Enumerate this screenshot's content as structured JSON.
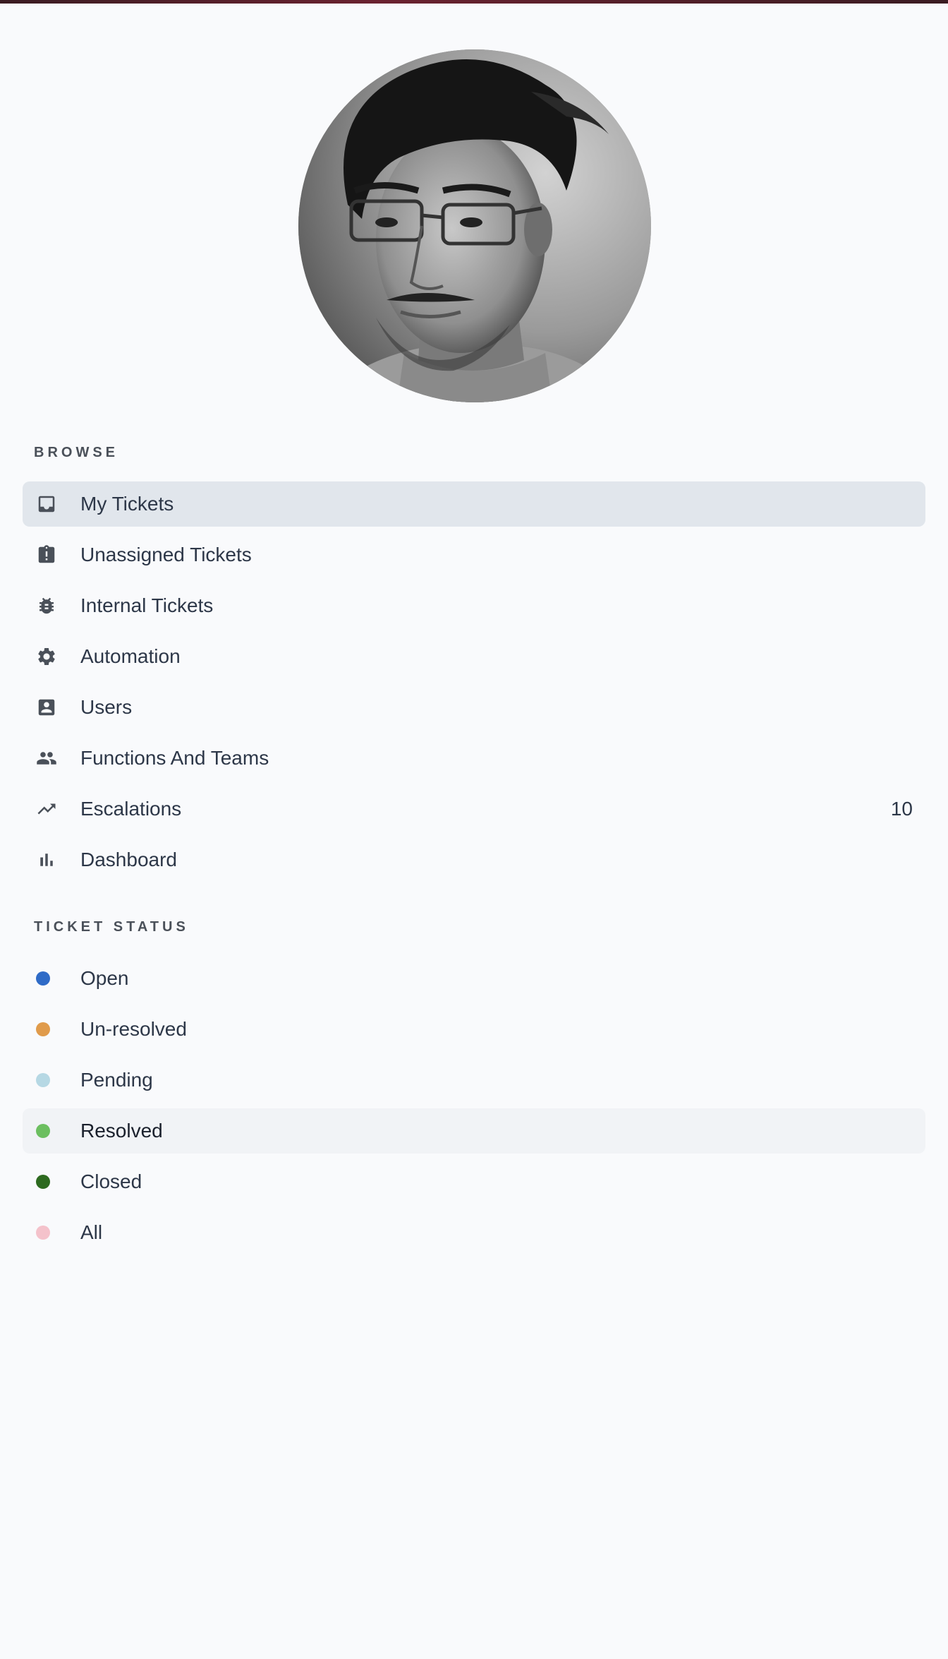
{
  "browse": {
    "heading": "BROWSE",
    "items": [
      {
        "label": "My Tickets",
        "icon": "inbox-icon"
      },
      {
        "label": "Unassigned Tickets",
        "icon": "clipboard-alert-icon"
      },
      {
        "label": "Internal Tickets",
        "icon": "bug-icon"
      },
      {
        "label": "Automation",
        "icon": "gear-icon"
      },
      {
        "label": "Users",
        "icon": "account-box-icon"
      },
      {
        "label": "Functions And Teams",
        "icon": "people-icon"
      },
      {
        "label": "Escalations",
        "icon": "trending-up-icon",
        "count": "10"
      },
      {
        "label": "Dashboard",
        "icon": "bar-chart-icon"
      }
    ]
  },
  "ticket_status": {
    "heading": "TICKET STATUS",
    "items": [
      {
        "label": "Open",
        "color": "#2f6bc7"
      },
      {
        "label": "Un-resolved",
        "color": "#e09b4b"
      },
      {
        "label": "Pending",
        "color": "#b6d8e4"
      },
      {
        "label": "Resolved",
        "color": "#6cbf60"
      },
      {
        "label": "Closed",
        "color": "#2d6a1f"
      },
      {
        "label": "All",
        "color": "#f4c2cb"
      }
    ]
  },
  "colors": {
    "background": "#f9fafc",
    "active_item": "#e1e6ec",
    "hover_item": "#f1f3f6",
    "icon": "#4a5059"
  }
}
